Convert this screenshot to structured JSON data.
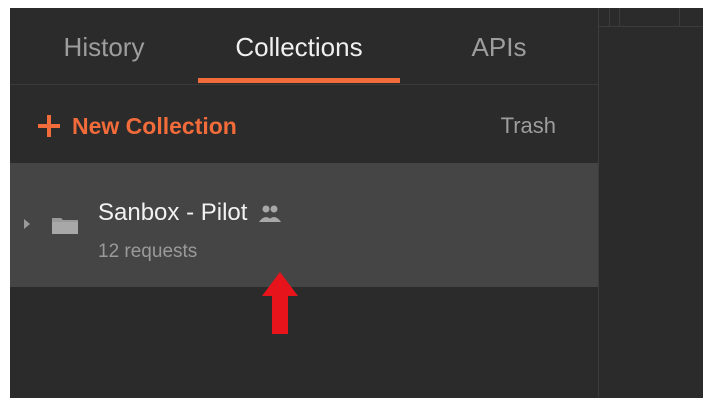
{
  "sidebar": {
    "tabs": [
      {
        "label": "History",
        "active": false
      },
      {
        "label": "Collections",
        "active": true
      },
      {
        "label": "APIs",
        "active": false
      }
    ],
    "actions": {
      "new_collection_label": "New Collection",
      "trash_label": "Trash"
    },
    "collections": [
      {
        "name": "Sanbox - Pilot",
        "meta": "12 requests",
        "shared": true,
        "icon": "folder-icon"
      }
    ]
  },
  "colors": {
    "accent": "#f26b3a",
    "background": "#2b2b2b",
    "selected_row": "#454545",
    "annotation_arrow": "#e8141b"
  },
  "annotation": {
    "icon": "red-arrow-icon"
  }
}
